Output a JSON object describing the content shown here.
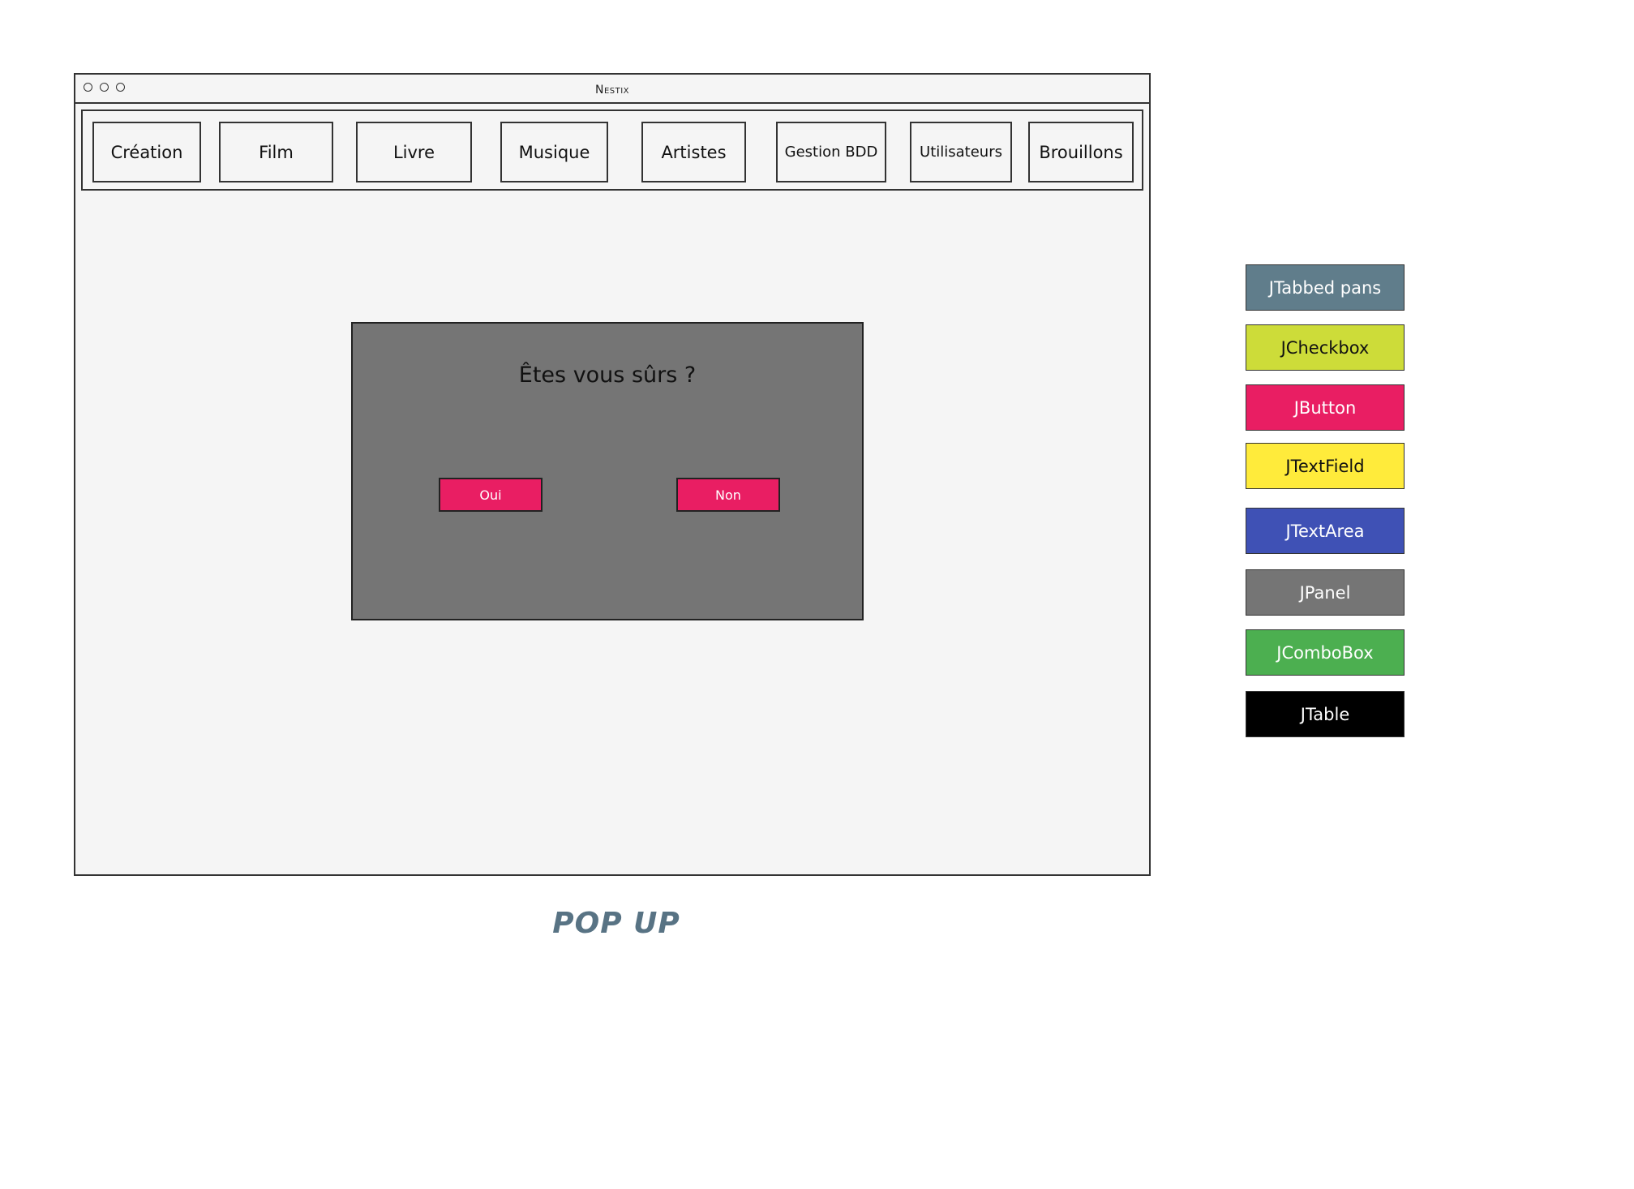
{
  "window": {
    "title": "Nestix",
    "tabs": [
      {
        "label": "Création"
      },
      {
        "label": "Film"
      },
      {
        "label": "Livre"
      },
      {
        "label": "Musique"
      },
      {
        "label": "Artistes"
      },
      {
        "label": "Gestion BDD"
      },
      {
        "label": "Utilisateurs"
      },
      {
        "label": "Brouillons"
      }
    ]
  },
  "popup": {
    "question": "Êtes vous sûrs  ?",
    "yes_label": "Oui",
    "no_label": "Non"
  },
  "caption": "POP UP",
  "legend": [
    {
      "label": "JTabbed pans",
      "color": "#607d8b",
      "text_color": "#ffffff"
    },
    {
      "label": "JCheckbox",
      "color": "#cddc39",
      "text_color": "#111111"
    },
    {
      "label": "JButton",
      "color": "#e91e63",
      "text_color": "#ffffff"
    },
    {
      "label": "JTextField",
      "color": "#ffeb3b",
      "text_color": "#111111"
    },
    {
      "label": "JTextArea",
      "color": "#3f51b5",
      "text_color": "#ffffff"
    },
    {
      "label": "JPanel",
      "color": "#757575",
      "text_color": "#ffffff"
    },
    {
      "label": "JComboBox",
      "color": "#4caf50",
      "text_color": "#ffffff"
    },
    {
      "label": "JTable",
      "color": "#000000",
      "text_color": "#ffffff"
    }
  ]
}
